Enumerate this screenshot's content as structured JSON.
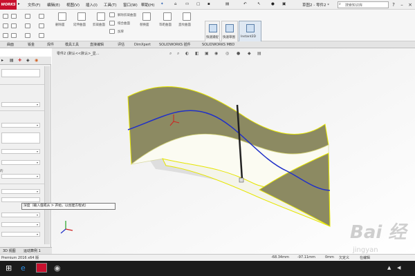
{
  "app": {
    "logo_text": "WORKS",
    "window_title": "草图2 - 零件2 *",
    "search_placeholder": "搜索知识库"
  },
  "menu": [
    "文件(F)",
    "编辑(E)",
    "视图(V)",
    "插入(I)",
    "工具(T)",
    "窗口(W)",
    "帮助(H)"
  ],
  "ribbon": {
    "small_labels": [
      "删除面",
      "延伸曲面",
      "剪裁曲面",
      "解除剪裁曲面",
      "缝合曲面",
      "加厚",
      "替换面",
      "等距曲面",
      "直纹曲面"
    ],
    "big_buttons": [
      "快速捕捉",
      "快速草图",
      "Instant2D"
    ]
  },
  "tabs": [
    "曲面",
    "钣金",
    "焊件",
    "模具工具",
    "直接编辑",
    "评估",
    "DimXpert",
    "SOLIDWORKS 插件",
    "SOLIDWORKS MBD"
  ],
  "feature_tree_path": "零件2 (默认<<默认>_显...",
  "left_panel": {
    "bottom_text": "的"
  },
  "tooltip": "深度（输入值或从 > 开始，以创建方程式）",
  "bottom_tabs": [
    "3D 视图",
    "运动算例 1"
  ],
  "status": {
    "left": "Premium 2016 x64 版",
    "x": "-68.34mm",
    "y": "-97.11mm",
    "z": "0mm",
    "state": "欠定义",
    "extra": "在编辑"
  },
  "watermark": {
    "text": "Bai 经",
    "sub": "jingyan"
  },
  "colors": {
    "surface_dark": "#8c8a62",
    "curve_blue": "#2030c8",
    "edge_yellow": "#e6e600",
    "logo_red": "#c8102e"
  }
}
